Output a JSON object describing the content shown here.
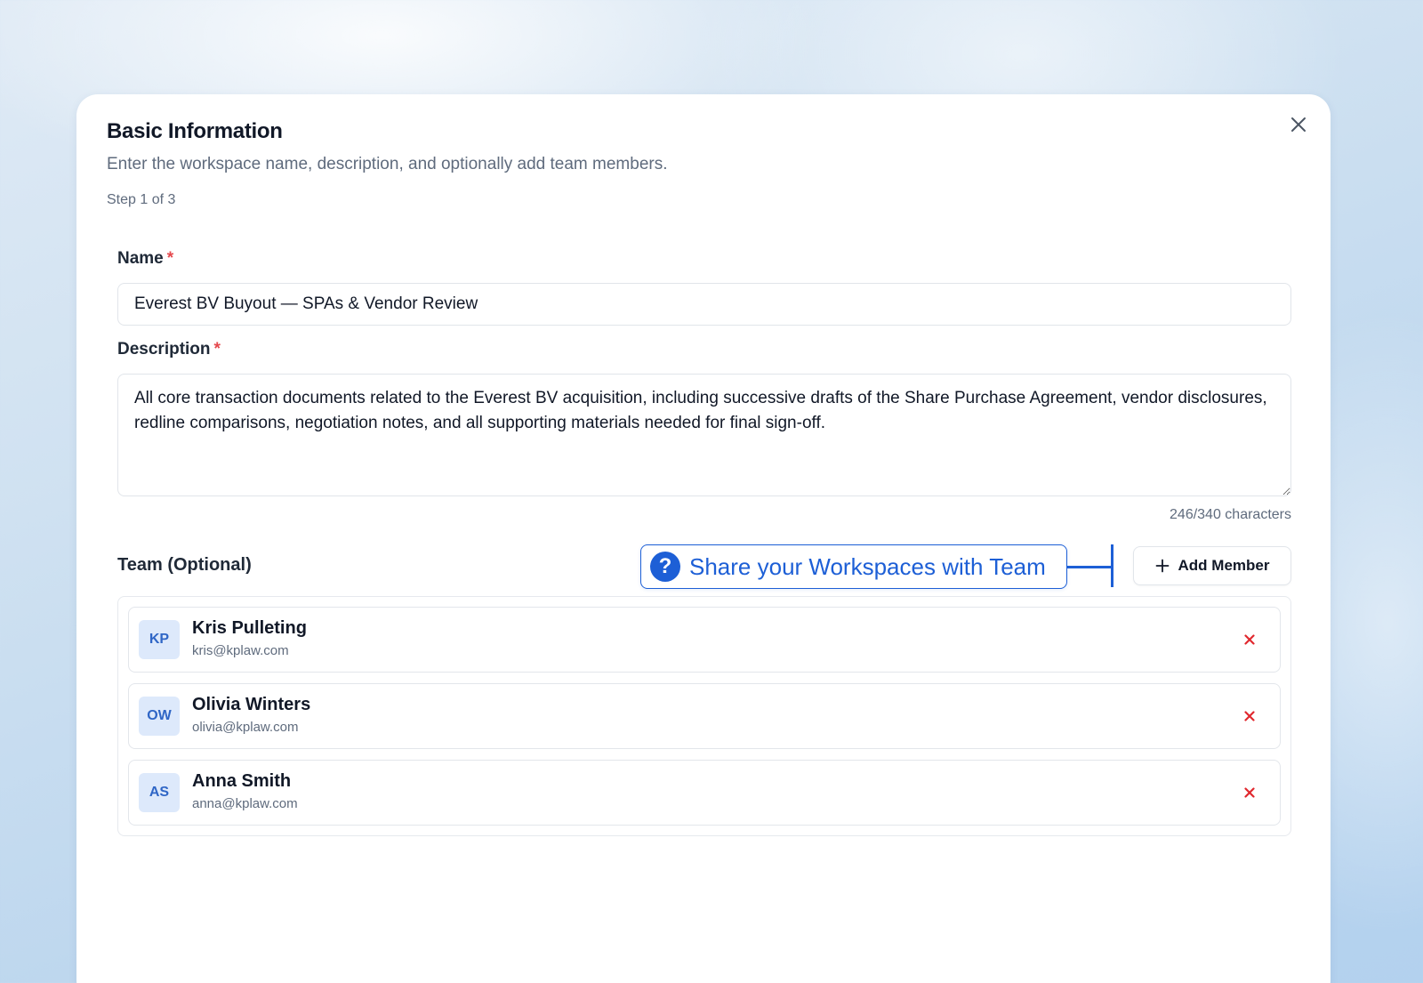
{
  "dialog": {
    "title": "Basic Information",
    "subtitle": "Enter the workspace name, description, and optionally add team members.",
    "step": "Step 1 of 3",
    "close_icon": "close-icon"
  },
  "form": {
    "name": {
      "label": "Name",
      "required_mark": "*",
      "value": "Everest BV Buyout — SPAs & Vendor Review"
    },
    "description": {
      "label": "Description",
      "required_mark": "*",
      "value": "All core transaction documents related to the Everest BV acquisition, including successive drafts of the Share Purchase Agreement, vendor disclosures, redline comparisons, negotiation notes, and all supporting materials needed for final sign-off.",
      "char_count": "246/340 characters"
    }
  },
  "team": {
    "label": "Team (Optional)",
    "callout": {
      "icon": "question-icon",
      "icon_glyph": "?",
      "text": "Share your Workspaces with Team"
    },
    "add_button": {
      "icon": "plus-icon",
      "label": "Add Member"
    },
    "members": [
      {
        "initials": "KP",
        "name": "Kris Pulleting",
        "email": "kris@kplaw.com"
      },
      {
        "initials": "OW",
        "name": "Olivia Winters",
        "email": "olivia@kplaw.com"
      },
      {
        "initials": "AS",
        "name": "Anna Smith",
        "email": "anna@kplaw.com"
      }
    ],
    "remove_icon": "remove-icon"
  },
  "colors": {
    "accent": "#1d5fd6",
    "required": "#e5484d",
    "remove": "#e0282e",
    "avatar_bg": "#dde9fb",
    "avatar_text": "#2f66c6"
  }
}
